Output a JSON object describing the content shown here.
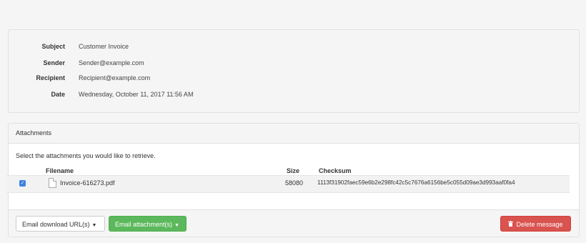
{
  "message": {
    "fields": [
      {
        "label": "Subject",
        "value": "Customer Invoice"
      },
      {
        "label": "Sender",
        "value": "Sender@example.com"
      },
      {
        "label": "Recipient",
        "value": "Recipient@example.com"
      },
      {
        "label": "Date",
        "value": "Wednesday, October 11, 2017 11:56 AM"
      }
    ]
  },
  "attachments": {
    "title": "Attachments",
    "instruction": "Select the attachments you would like to retrieve.",
    "columns": {
      "filename": "Filename",
      "size": "Size",
      "checksum": "Checksum"
    },
    "rows": [
      {
        "checked": true,
        "filename": "Invoice-616273.pdf",
        "size": "58080",
        "checksum": "1113f31902faec59e6b2e298fc42c5c7676a6156be5c055d09ae3d993aaf0fa4",
        "icon": "file-icon"
      }
    ]
  },
  "actions": {
    "email_download_label": "Email download URL(s)",
    "email_attachment_label": "Email attachment(s)",
    "delete_label": "Delete message"
  },
  "colors": {
    "success": "#5cb85c",
    "danger": "#d9534f",
    "checkbox": "#3b82e0"
  }
}
